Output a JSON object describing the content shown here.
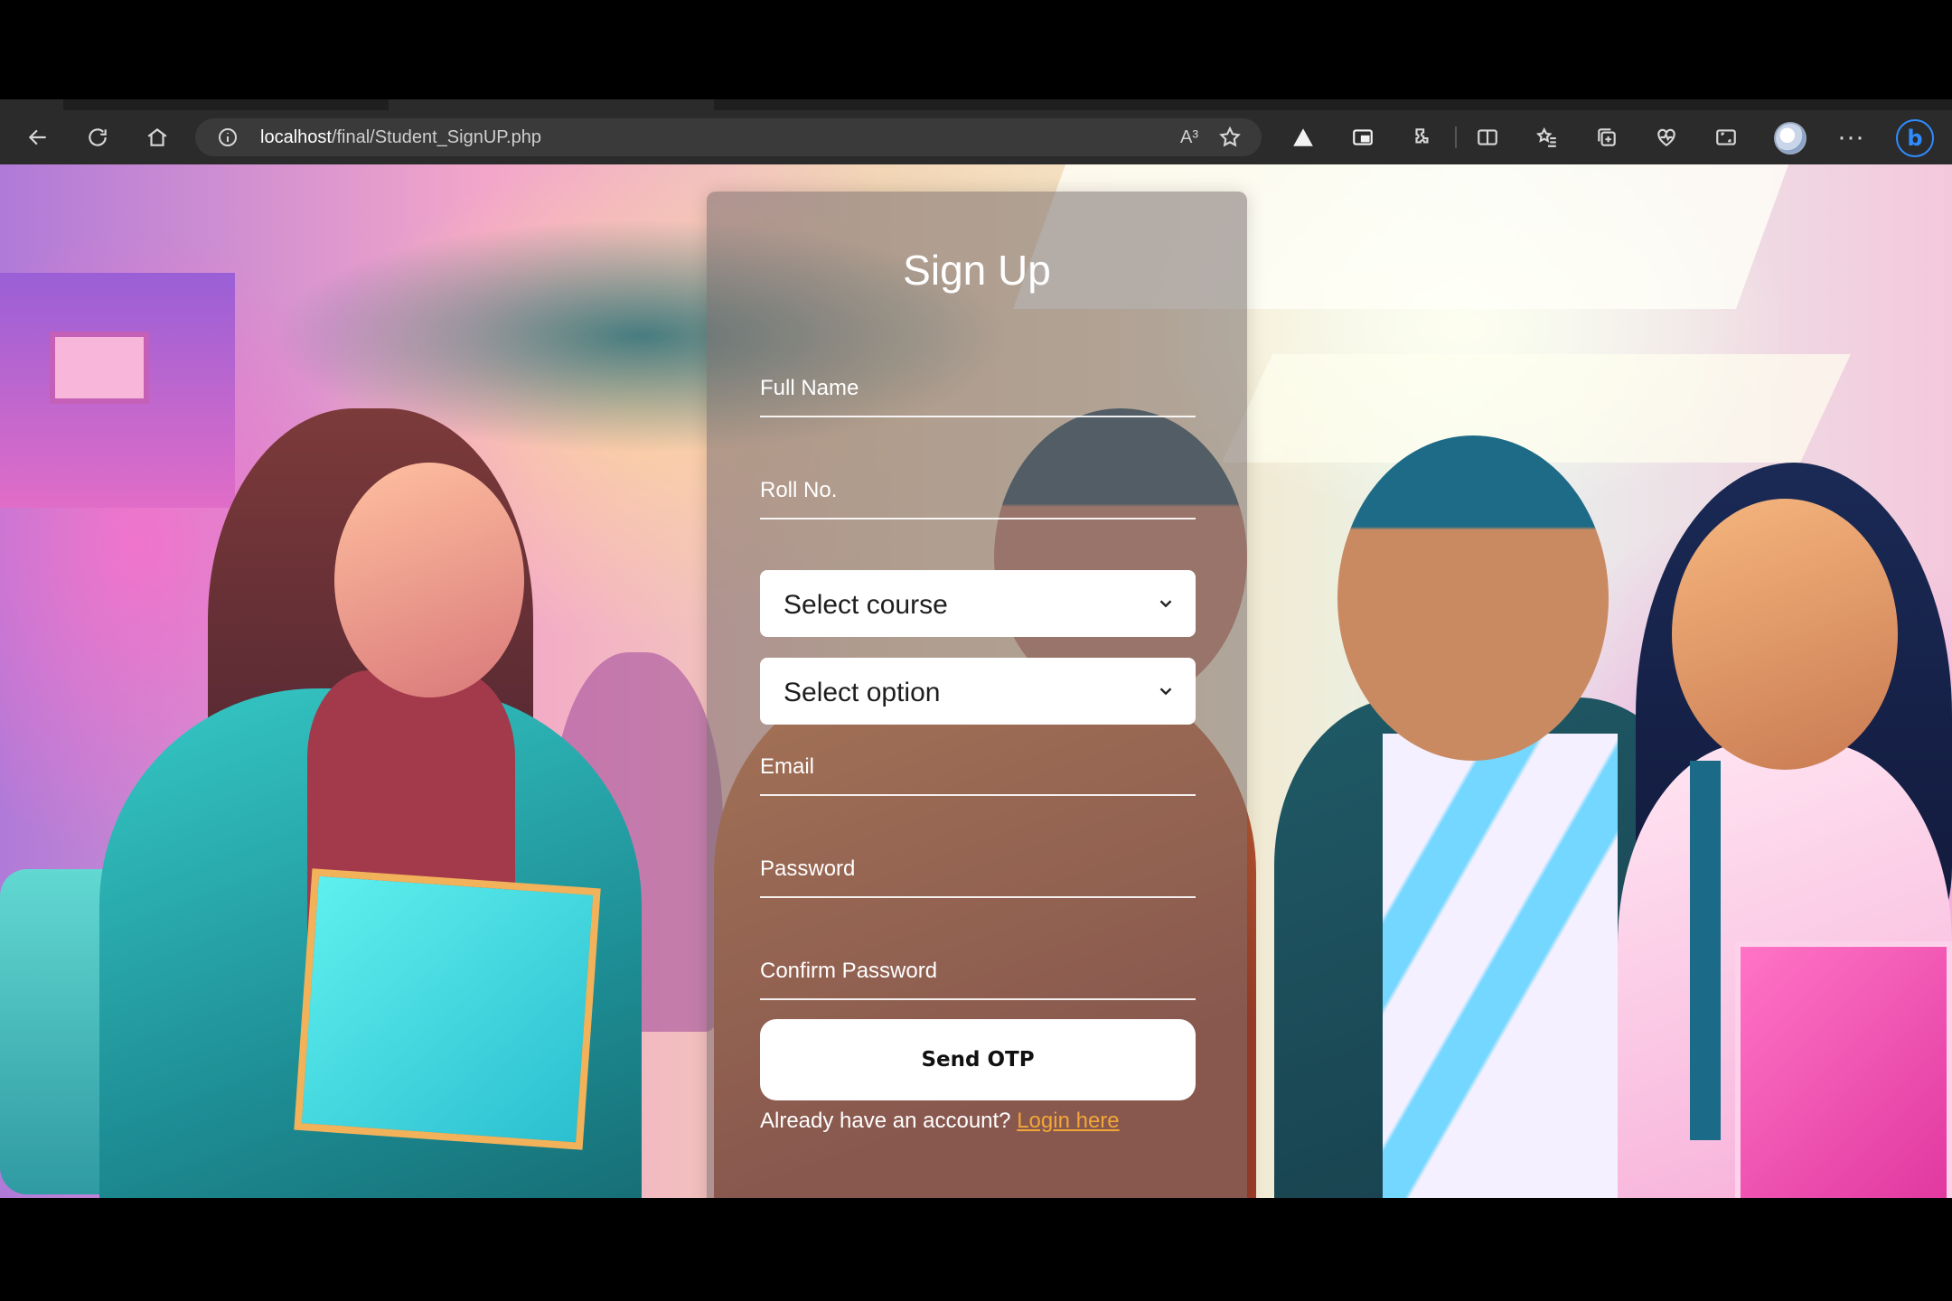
{
  "browser": {
    "address": {
      "host": "localhost",
      "path": "/final/Student_SignUP.php"
    },
    "icons": {
      "back": "back-arrow-icon",
      "refresh": "refresh-icon",
      "home": "home-icon",
      "site_info": "info-circle-icon",
      "read_aloud": "read-aloud-icon",
      "favorite": "star-icon",
      "extensions": [
        "warning-triangle-icon",
        "cast-icon",
        "puzzle-icon",
        "split-screen-icon",
        "favorites-icon",
        "collections-icon",
        "heart-pulse-icon",
        "screenshot-icon"
      ],
      "more": "more-icon",
      "copilot": "bing-icon"
    },
    "read_aloud_glyph": "A³",
    "more_glyph": "···",
    "bing_glyph": "b"
  },
  "form": {
    "title": "Sign Up",
    "fields": {
      "full_name": "Full Name",
      "roll_no": "Roll No.",
      "email": "Email",
      "password": "Password",
      "confirm_password": "Confirm Password"
    },
    "selects": {
      "course": "Select course",
      "option": "Select option"
    },
    "submit_label": "Send OTP",
    "login_prompt": "Already have an account?",
    "login_link": "Login here"
  },
  "colors": {
    "link": "#f0a638",
    "card": "rgba(120,110,110,0.55)",
    "toolbar": "#2b2b2b",
    "bing_accent": "#2f8cff"
  }
}
